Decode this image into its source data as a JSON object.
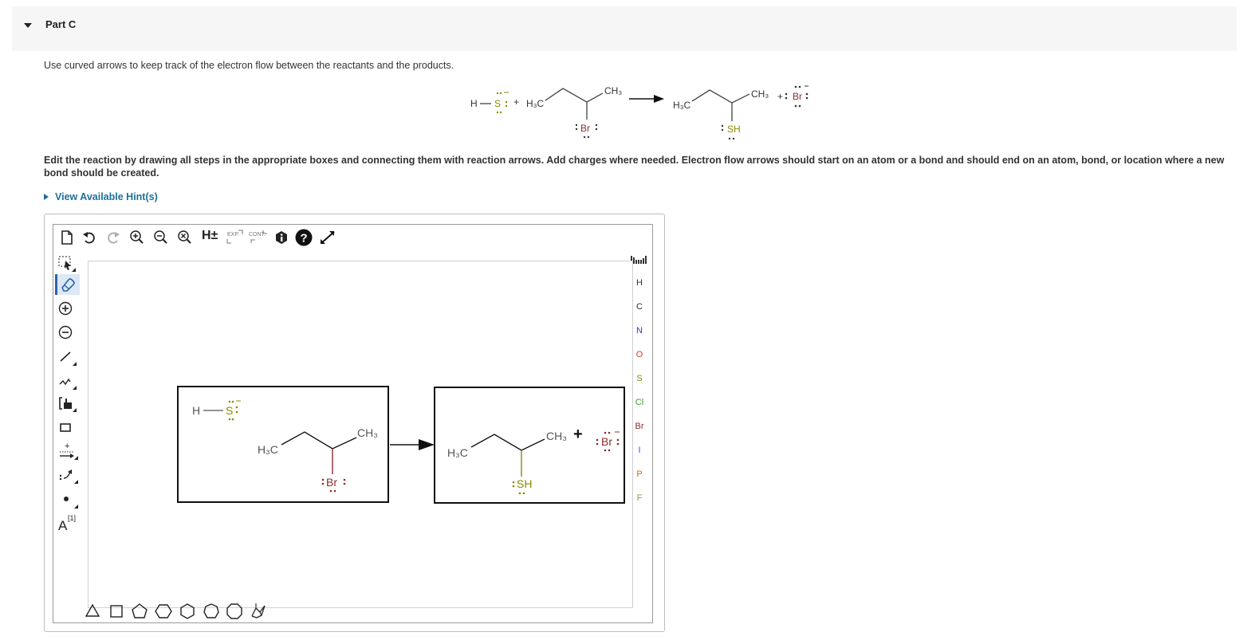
{
  "part": {
    "title": "Part C"
  },
  "instruction": "Use curved arrows to keep track of the electron flow between the reactants and the products.",
  "edit_instruction": "Edit the reaction by drawing all steps in the appropriate boxes and connecting them with reaction arrows. Add charges where needed. Electron flow arrows should start on an atom or a bond and should end on an atom, bond, or location where a new bond should be created.",
  "hints": {
    "label": "View Available Hint(s)"
  },
  "reaction_header": {
    "h": "H",
    "s": "S",
    "plus1": "+",
    "h3c": "H₃C",
    "ch3": "CH₃",
    "br": "Br",
    "h3c_p": "H₃C",
    "ch3_p": "CH₃",
    "sh": "SH",
    "plus2": "+",
    "br_p": "Br"
  },
  "toolbar": {
    "h_label": "H±",
    "exp_label": "EXP.",
    "cont_label": "CONT."
  },
  "canvas": {
    "box1": {
      "h": "H",
      "s": "S",
      "h3c": "H₃C",
      "ch3": "CH₃",
      "br": "Br"
    },
    "box2": {
      "h3c": "H₃C",
      "ch3": "CH₃",
      "plus": "+",
      "br": "Br",
      "sh": "SH"
    }
  },
  "side_tools": {
    "atom_label": "A",
    "atom_index": "[1]"
  },
  "elements": [
    {
      "symbol": "H",
      "color": "#333333"
    },
    {
      "symbol": "C",
      "color": "#333333"
    },
    {
      "symbol": "N",
      "color": "#3333cc"
    },
    {
      "symbol": "O",
      "color": "#e03030"
    },
    {
      "symbol": "S",
      "color": "#8a8a00"
    },
    {
      "symbol": "Cl",
      "color": "#2e9e2e"
    },
    {
      "symbol": "Br",
      "color": "#8b2c2c"
    },
    {
      "symbol": "I",
      "color": "#8a2be2"
    },
    {
      "symbol": "P",
      "color": "#d07000"
    },
    {
      "symbol": "F",
      "color": "#7aa83a"
    }
  ],
  "colors": {
    "link": "#1d6f9b",
    "sulfur": "#8a8a00",
    "bromine": "#8b2c2c",
    "header_bg": "#f6f6f6"
  }
}
